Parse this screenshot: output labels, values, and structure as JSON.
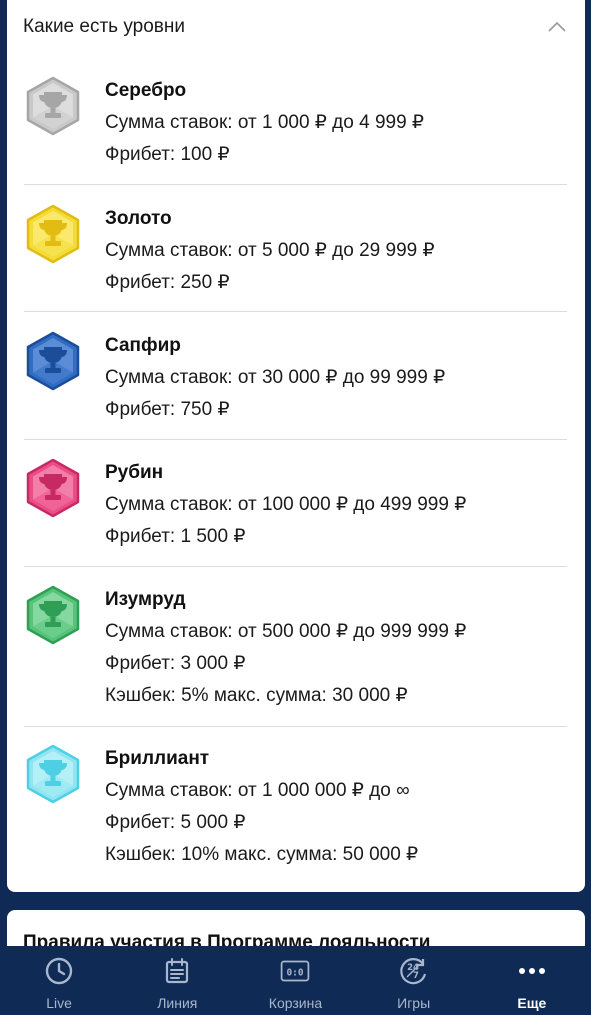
{
  "levels_card": {
    "title": "Какие есть уровни",
    "toggle_icon": "chevron-up-icon"
  },
  "levels": [
    {
      "name": "Серебро",
      "color": "#c9c9c9",
      "dark": "#a6a6a6",
      "light": "#ececec",
      "lines": [
        "Сумма ставок: от 1 000 ₽ до 4 999 ₽",
        "Фрибет: 100 ₽"
      ]
    },
    {
      "name": "Золото",
      "color": "#f3dc35",
      "dark": "#e2bc12",
      "light": "#fff49b",
      "lines": [
        "Сумма ставок: от 5 000 ₽ до 29 999 ₽",
        "Фрибет: 250 ₽"
      ]
    },
    {
      "name": "Сапфир",
      "color": "#2f6ec4",
      "dark": "#1b4d98",
      "light": "#7ea8e4",
      "lines": [
        "Сумма ставок: от 30 000 ₽ до 99 999 ₽",
        "Фрибет: 750 ₽"
      ]
    },
    {
      "name": "Рубин",
      "color": "#ec4d86",
      "dark": "#c72a62",
      "light": "#f6a9c5",
      "lines": [
        "Сумма ставок: от 100 000 ₽ до 499 999 ₽",
        "Фрибет: 1 500 ₽"
      ]
    },
    {
      "name": "Изумруд",
      "color": "#55c47a",
      "dark": "#2f9f56",
      "light": "#aee7bf",
      "lines": [
        "Сумма ставок: от 500 000 ₽ до 999 999 ₽",
        "Фрибет: 3 000 ₽",
        "Кэшбек: 5% макс. сумма: 30 000 ₽"
      ]
    },
    {
      "name": "Бриллиант",
      "color": "#8fe6f2",
      "dark": "#4fcfe3",
      "light": "#d6f7fb",
      "lines": [
        "Сумма ставок: от 1 000 000 ₽ до ∞",
        "Фрибет: 5 000 ₽",
        "Кэшбек: 10% макс. сумма: 50 000 ₽"
      ]
    }
  ],
  "rules_card": {
    "title": "Правила участия в Программе лояльности"
  },
  "tabbar": {
    "items": [
      {
        "label": "Live",
        "icon": "clock-icon",
        "active": false
      },
      {
        "label": "Линия",
        "icon": "calendar-icon",
        "active": false
      },
      {
        "label": "Корзина",
        "icon": "scoreboard-icon",
        "active": false
      },
      {
        "label": "Игры",
        "icon": "24-7-icon",
        "active": false
      },
      {
        "label": "Еще",
        "icon": "more-dots-icon",
        "active": true
      }
    ],
    "active_color": "#ffffff",
    "inactive_color": "#a9b6cc"
  }
}
